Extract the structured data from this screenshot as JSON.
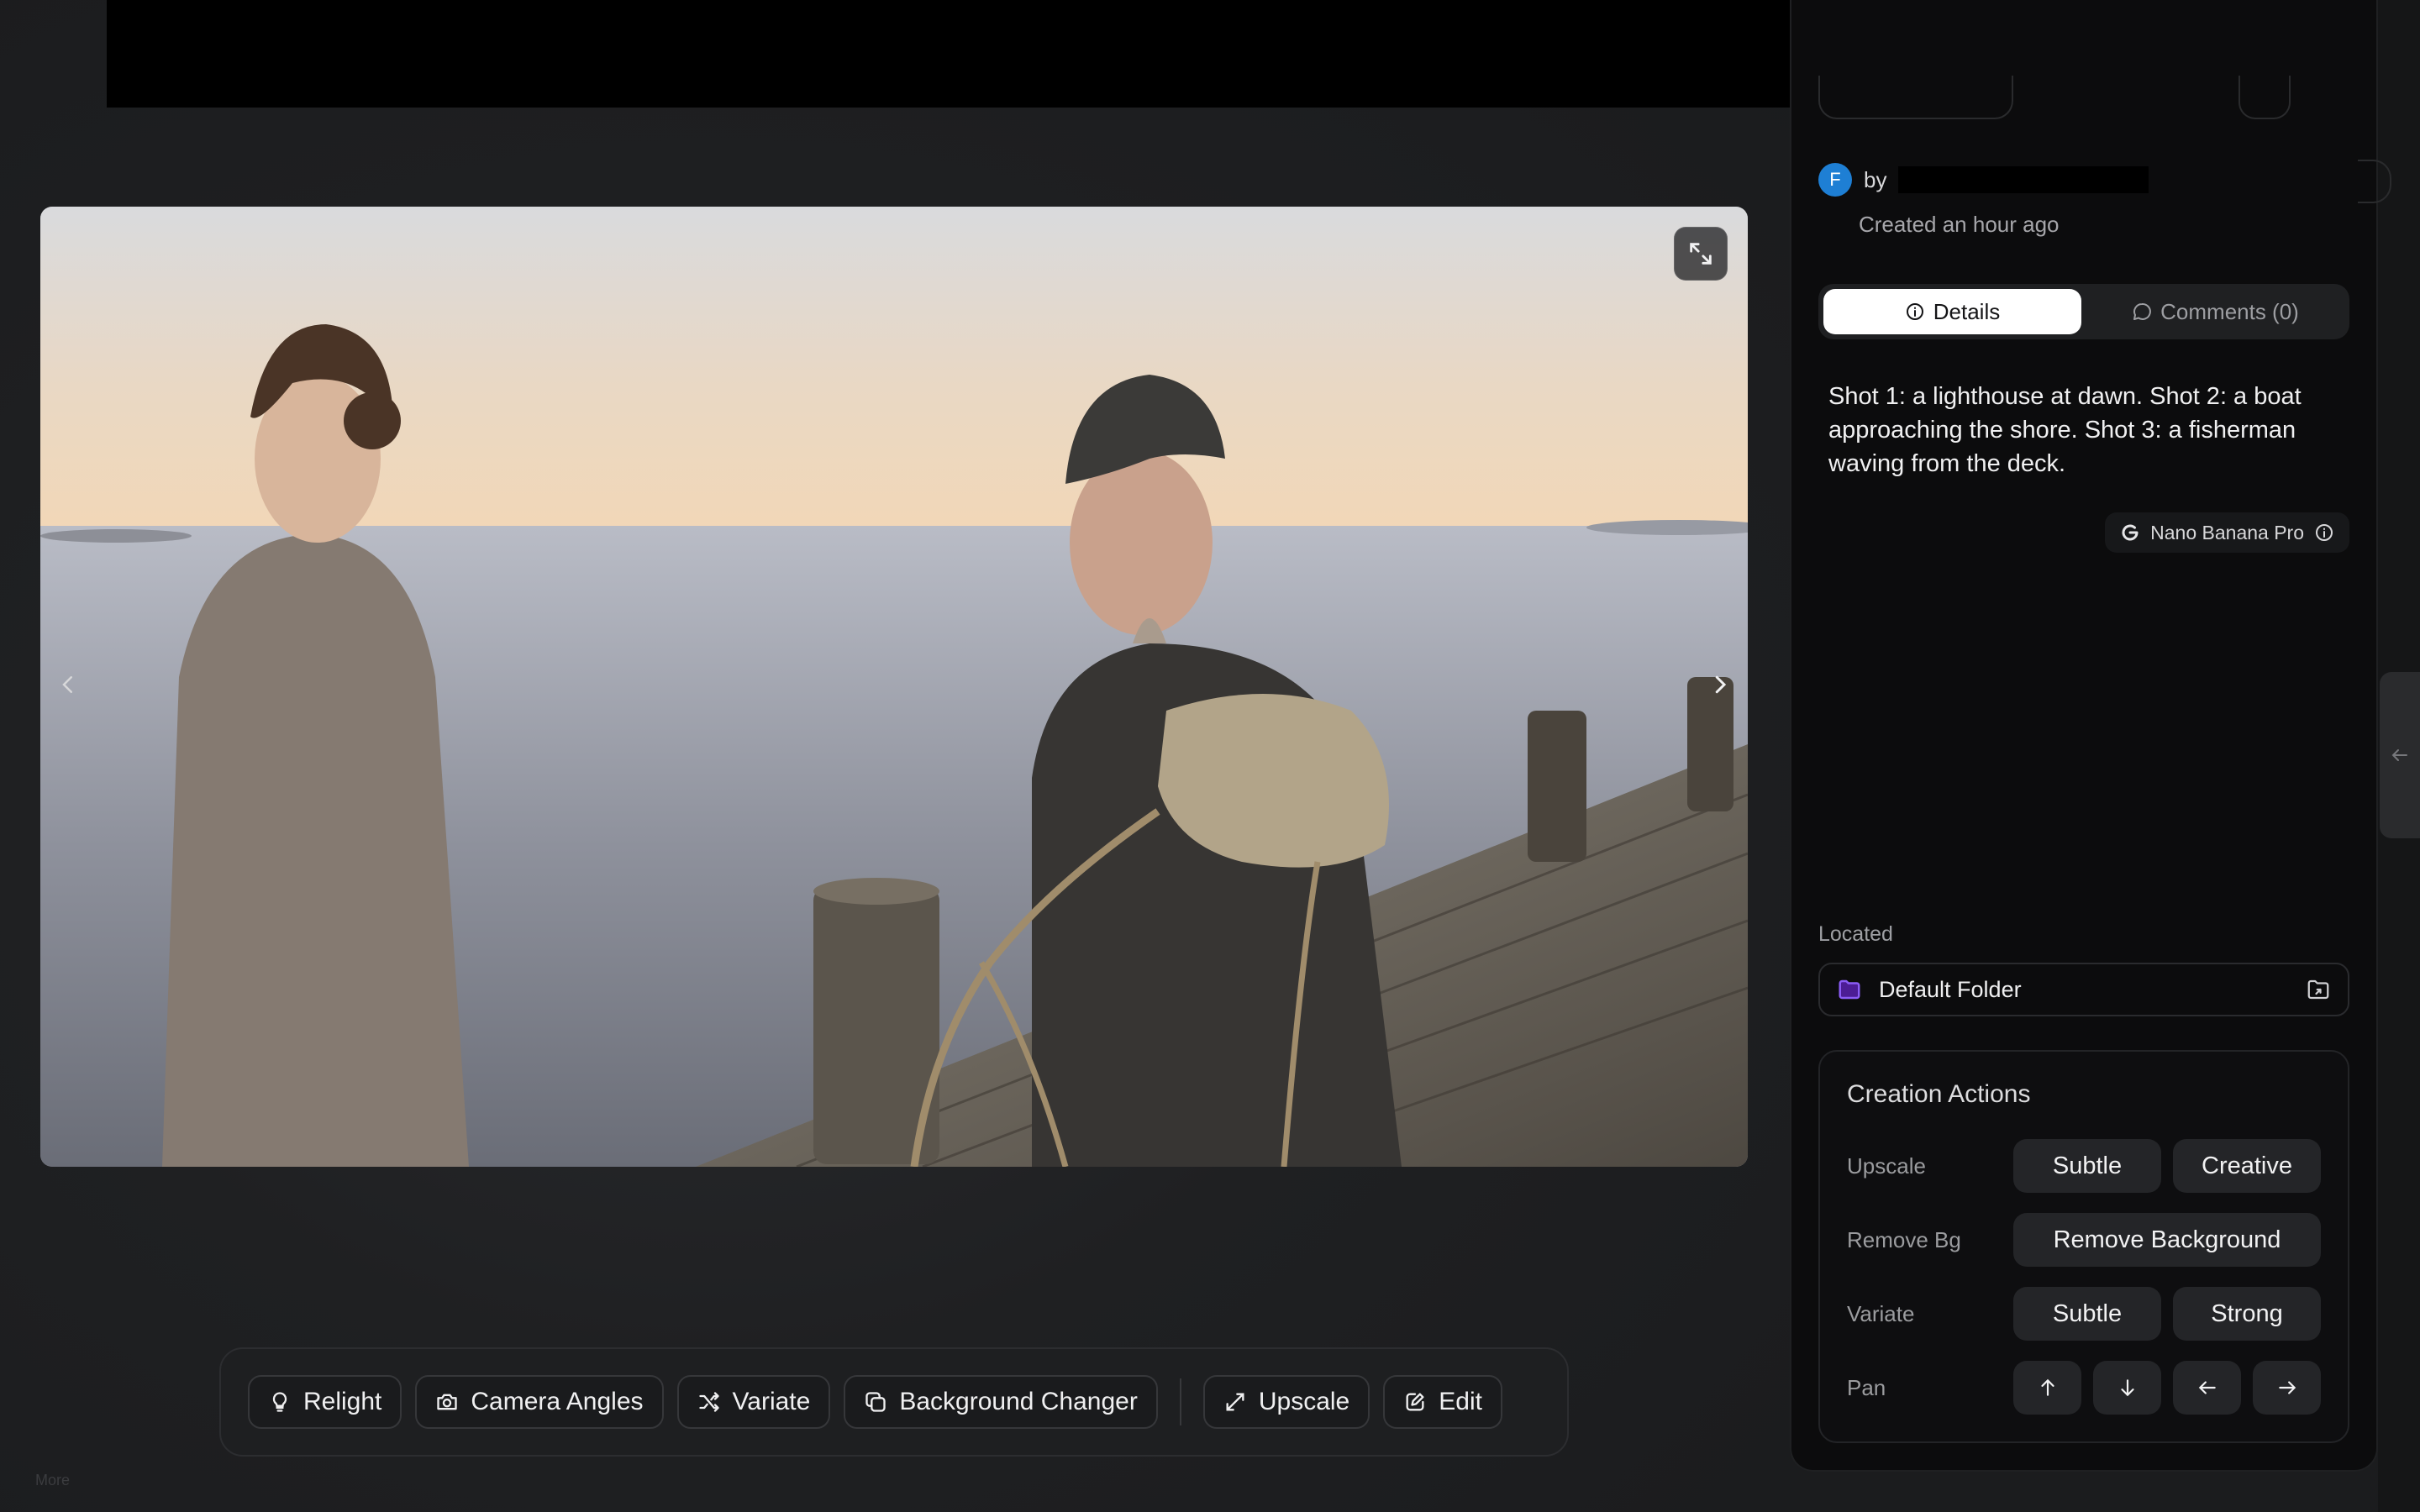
{
  "sidebar": {
    "avatar_letter": "F",
    "by_label": "by",
    "created": "Created an hour ago",
    "tabs": [
      {
        "label": "Details",
        "active": true
      },
      {
        "label": "Comments (0)",
        "active": false
      }
    ],
    "prompt": "Shot 1: a lighthouse at dawn. Shot 2: a boat approaching the shore. Shot 3: a fisherman waving from the deck.",
    "model": "Nano Banana Pro",
    "located_label": "Located",
    "folder": "Default Folder",
    "creation_actions": {
      "title": "Creation Actions",
      "rows": [
        {
          "label": "Upscale",
          "buttons": [
            "Subtle",
            "Creative"
          ]
        },
        {
          "label": "Remove Bg",
          "buttons": [
            "Remove Background"
          ]
        },
        {
          "label": "Variate",
          "buttons": [
            "Subtle",
            "Strong"
          ]
        },
        {
          "label": "Pan",
          "buttons": [
            "up-arrow-icon",
            "down-arrow-icon",
            "left-arrow-icon",
            "right-arrow-icon"
          ]
        }
      ]
    }
  },
  "toolbar": {
    "items": [
      {
        "label": "Relight",
        "icon": "lightbulb-icon"
      },
      {
        "label": "Camera Angles",
        "icon": "camera-icon"
      },
      {
        "label": "Variate",
        "icon": "shuffle-icon"
      },
      {
        "label": "Background Changer",
        "icon": "layers-icon"
      },
      {
        "label": "Upscale",
        "icon": "diagonal-expand-icon"
      },
      {
        "label": "Edit",
        "icon": "edit-sparkle-icon"
      }
    ]
  },
  "footer": {
    "more": "More"
  },
  "colors": {
    "avatar": "#1e7fd4",
    "folder_icon": "#8b5cf6",
    "panel_bg": "#0c0c0d"
  }
}
